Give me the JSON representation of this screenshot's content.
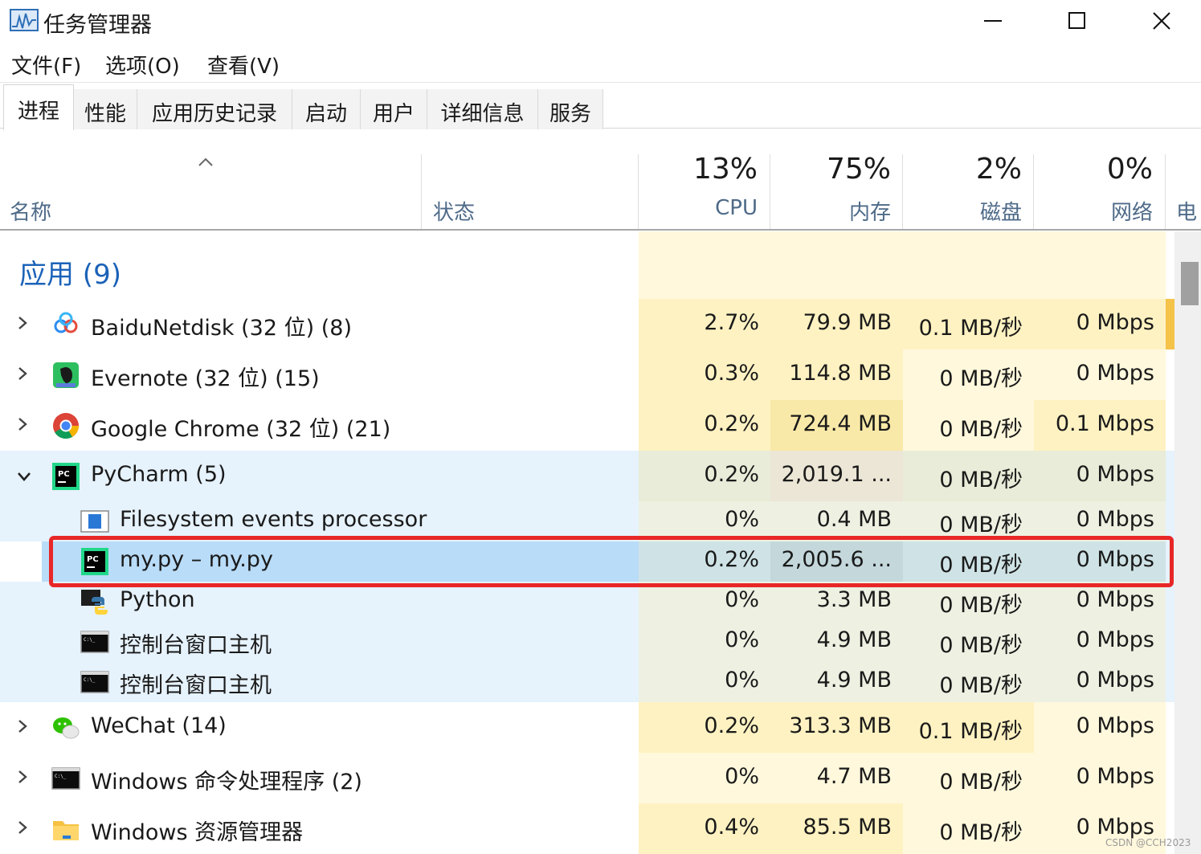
{
  "window": {
    "title": "任务管理器",
    "controls": {
      "minimize": "minimize",
      "maximize": "maximize",
      "close": "close"
    }
  },
  "menu": [
    "文件(F)",
    "选项(O)",
    "查看(V)"
  ],
  "tabs": [
    "进程",
    "性能",
    "应用历史记录",
    "启动",
    "用户",
    "详细信息",
    "服务"
  ],
  "columns": {
    "name": "名称",
    "status": "状态",
    "cpu": {
      "pct": "13%",
      "label": "CPU"
    },
    "memory": {
      "pct": "75%",
      "label": "内存"
    },
    "disk": {
      "pct": "2%",
      "label": "磁盘"
    },
    "network": {
      "pct": "0%",
      "label": "网络"
    },
    "power": "电"
  },
  "group": {
    "title": "应用 (9)"
  },
  "rows": [
    {
      "name": "BaiduNetdisk (32 位) (8)",
      "cpu": "2.7%",
      "mem": "79.9 MB",
      "disk": "0.1 MB/秒",
      "net": "0 Mbps",
      "icon": "baidu-netdisk-icon",
      "expander": "chevron-right-icon"
    },
    {
      "name": "Evernote (32 位) (15)",
      "cpu": "0.3%",
      "mem": "114.8 MB",
      "disk": "0 MB/秒",
      "net": "0 Mbps",
      "icon": "evernote-icon",
      "expander": "chevron-right-icon"
    },
    {
      "name": "Google Chrome (32 位) (21)",
      "cpu": "0.2%",
      "mem": "724.4 MB",
      "disk": "0 MB/秒",
      "net": "0.1 Mbps",
      "icon": "chrome-icon",
      "expander": "chevron-right-icon"
    },
    {
      "name": "PyCharm (5)",
      "cpu": "0.2%",
      "mem": "2,019.1 ...",
      "disk": "0 MB/秒",
      "net": "0 Mbps",
      "icon": "pycharm-icon",
      "expander": "chevron-down-icon"
    },
    {
      "name": "Filesystem events processor",
      "cpu": "0%",
      "mem": "0.4 MB",
      "disk": "0 MB/秒",
      "net": "0 Mbps",
      "icon": "app-window-icon"
    },
    {
      "name": "my.py – my.py",
      "cpu": "0.2%",
      "mem": "2,005.6 ...",
      "disk": "0 MB/秒",
      "net": "0 Mbps",
      "icon": "pycharm-icon"
    },
    {
      "name": "Python",
      "cpu": "0%",
      "mem": "3.3 MB",
      "disk": "0 MB/秒",
      "net": "0 Mbps",
      "icon": "python-icon"
    },
    {
      "name": "控制台窗口主机",
      "cpu": "0%",
      "mem": "4.9 MB",
      "disk": "0 MB/秒",
      "net": "0 Mbps",
      "icon": "console-icon"
    },
    {
      "name": "控制台窗口主机",
      "cpu": "0%",
      "mem": "4.9 MB",
      "disk": "0 MB/秒",
      "net": "0 Mbps",
      "icon": "console-icon"
    },
    {
      "name": "WeChat (14)",
      "cpu": "0.2%",
      "mem": "313.3 MB",
      "disk": "0.1 MB/秒",
      "net": "0 Mbps",
      "icon": "wechat-icon",
      "expander": "chevron-right-icon"
    },
    {
      "name": "Windows 命令处理程序 (2)",
      "cpu": "0%",
      "mem": "4.7 MB",
      "disk": "0 MB/秒",
      "net": "0 Mbps",
      "icon": "console-icon",
      "expander": "chevron-right-icon"
    },
    {
      "name": "Windows 资源管理器",
      "cpu": "0.4%",
      "mem": "85.5 MB",
      "disk": "0 MB/秒",
      "net": "0 Mbps",
      "icon": "folder-icon",
      "expander": "chevron-right-icon"
    }
  ],
  "colors": {
    "heat_light": "#fff8dc",
    "heat_mid": "#fff2c2",
    "heat_strong": "#f9e9a8",
    "group_bg": "#e6f2fc",
    "selected_bg": "#b9dcf8",
    "accent": "#1b62b8",
    "highlight_border": "#e82727"
  },
  "watermark": "CSDN @CCH2023"
}
